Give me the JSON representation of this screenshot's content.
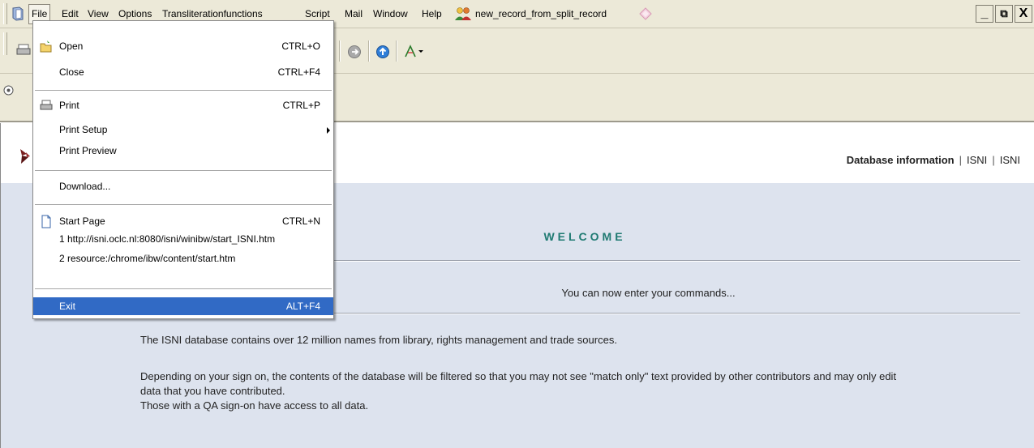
{
  "menubar": {
    "items": [
      "File",
      "Edit",
      "View",
      "Options",
      "Transliterationfunctions",
      "Script",
      "Mail",
      "Window",
      "Help"
    ],
    "record_title": "new_record_from_split_record"
  },
  "window_controls": {
    "minimize": "_",
    "restore": "⧉",
    "close": "X"
  },
  "file_menu": {
    "open": {
      "label": "Open",
      "shortcut": "CTRL+O"
    },
    "close": {
      "label": "Close",
      "shortcut": "CTRL+F4"
    },
    "print": {
      "label": "Print",
      "shortcut": "CTRL+P"
    },
    "print_setup": {
      "label": "Print Setup"
    },
    "print_preview": {
      "label": "Print Preview"
    },
    "download": {
      "label": "Download..."
    },
    "start_page": {
      "label": "Start Page",
      "shortcut": "CTRL+N"
    },
    "recent_1": {
      "label": "1 http://isni.oclc.nl:8080/isni/winibw/start_ISNI.htm"
    },
    "recent_2": {
      "label": "2 resource:/chrome/ibw/content/start.htm"
    },
    "exit": {
      "label": "Exit",
      "shortcut": "ALT+F4"
    }
  },
  "header": {
    "link_database": "Database information",
    "link_isni_1": "ISNI",
    "link_isni_2": "ISNI",
    "separator": "|"
  },
  "main": {
    "welcome": "WELCOME",
    "commands": "You can now enter your commands...",
    "para1": "The ISNI database contains over 12 million names from library, rights management and trade sources.",
    "para2_line1": "Depending on your sign on, the contents of the database will be filtered so that you may not see \"match only\" text provided by other contributors and may only edit",
    "para2_line2": "data that you have contributed.",
    "para2_line3": "Those with a QA sign-on have access to all data."
  },
  "colors": {
    "chrome": "#ece9d8",
    "content_bg": "#dde3ee",
    "welcome": "#1f7a72",
    "menu_selected": "#316ac5"
  }
}
